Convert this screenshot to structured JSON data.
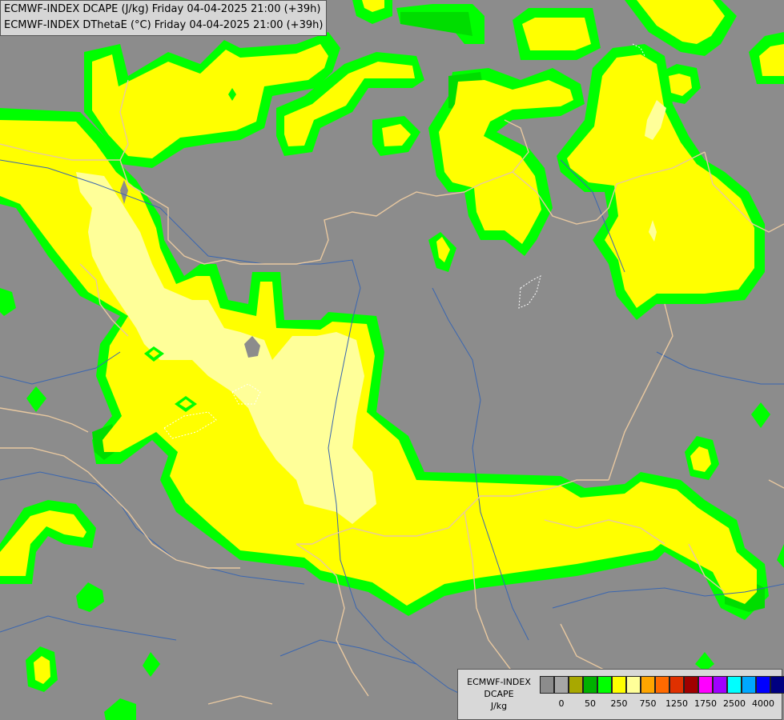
{
  "header": {
    "line1": "ECMWF-INDEX DCAPE (J/kg) Friday 04-04-2025 21:00 (+39h)",
    "line2": "ECMWF-INDEX DThetaE (°C) Friday 04-04-2025 21:00 (+39h)"
  },
  "legend": {
    "title_line1": "ECMWF-INDEX",
    "title_line2": "DCAPE",
    "unit": "J/kg",
    "colors": [
      "#8c8c8c",
      "#a6a6a6",
      "#a8a800",
      "#00b000",
      "#00ff00",
      "#ffff00",
      "#ffff99",
      "#ffa500",
      "#ff6a00",
      "#e03000",
      "#a00000",
      "#ff00ff",
      "#a000ff",
      "#00ffff",
      "#00a8ff",
      "#0000ff",
      "#000080"
    ],
    "tick_labels": [
      "0",
      "50",
      "250",
      "750",
      "1250",
      "1750",
      "2500",
      "4000"
    ]
  },
  "colors": {
    "background": "#8c8c8c",
    "dcape_green": "#00ff00",
    "dcape_yellow": "#ffff00",
    "dcape_lightyellow": "#ffff99",
    "borders": "#e8c8a0",
    "rivers": "#3a66b0"
  }
}
